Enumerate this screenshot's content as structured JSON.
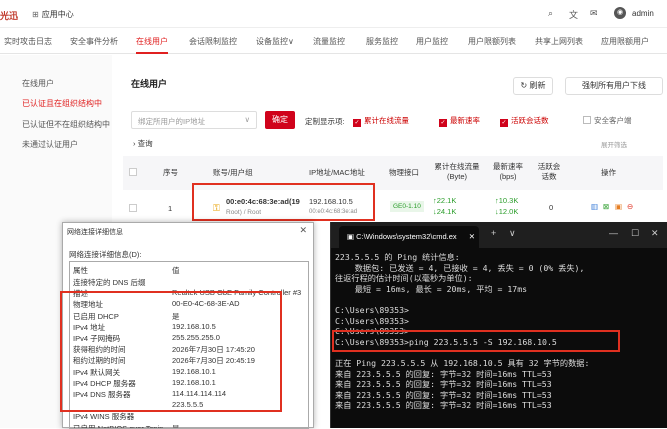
{
  "topbar": {
    "logo": "光迅",
    "app_center": "应用中心",
    "admin": "admin"
  },
  "nav": [
    "实时攻击日志",
    "安全事件分析",
    "在线用户",
    "会话限制监控",
    "设备监控∨",
    "流量监控",
    "服务监控",
    "用户监控",
    "用户限额列表",
    "共享上网列表",
    "应用限额用户"
  ],
  "left": [
    "在线用户",
    "已认证且在组织结构中",
    "已认证但不在组织结构中",
    "未通过认证用户"
  ],
  "main": {
    "title": "在线用户",
    "refresh": "刷新",
    "force_offline": "强制所有用户下线",
    "select_placeholder": "绑定所用户的IP地址",
    "confirm": "确定",
    "custom_label": "定制显示项:",
    "checks": [
      "累计在线流量",
      "最新速率",
      "活跃会话数",
      "安全客户端"
    ],
    "query": "查询",
    "expand": "展开筛选",
    "headers": [
      "序号",
      "账号/用户组",
      "IP地址/MAC地址",
      "物理接口",
      "累计在线流量 (Byte)",
      "最新速率 (bps)",
      "活跃会话数",
      "操作"
    ],
    "row": {
      "no": "1",
      "account": "00:e0:4c:68:3e:ad(19",
      "group": "Root) / Root",
      "ip": "192.168.10.5",
      "mac": "00:e0:4c:68:3e:ad",
      "iface": "GE0-1.10",
      "up": "↑22.1K",
      "down": "↓24.1K",
      "rate_up": "↑10.3K",
      "rate_down": "↓12.0K",
      "sessions": "0"
    }
  },
  "dialog": {
    "title": "网络连接详细信息",
    "label": "网络连接详细信息(D):",
    "col_prop": "属性",
    "col_val": "值",
    "rows": [
      [
        "连接特定的 DNS 后缀",
        ""
      ],
      [
        "描述",
        "Realtek USB GbE Family Controller #3"
      ],
      [
        "物理地址",
        "00-E0-4C-68-3E-AD"
      ],
      [
        "已启用 DHCP",
        "是"
      ],
      [
        "IPv4 地址",
        "192.168.10.5"
      ],
      [
        "IPv4 子网掩码",
        "255.255.255.0"
      ],
      [
        "获得租约的时间",
        "2026年7月30日 17:45:20"
      ],
      [
        "租约过期的时间",
        "2026年7月30日 20:45:19"
      ],
      [
        "IPv4 默认网关",
        "192.168.10.1"
      ],
      [
        "IPv4 DHCP 服务器",
        "192.168.10.1"
      ],
      [
        "IPv4 DNS 服务器",
        "114.114.114.114"
      ],
      [
        "",
        "223.5.5.5"
      ],
      [
        "IPv4 WINS 服务器",
        ""
      ],
      [
        "已启用 NetBIOS over Tcpip",
        "是"
      ]
    ]
  },
  "cmd": {
    "title": "C:\\Windows\\system32\\cmd.ex",
    "lines": [
      "223.5.5.5 的 Ping 统计信息:",
      "    数据包: 已发送 = 4, 已接收 = 4, 丢失 = 0 (0% 丢失),",
      "往返行程的估计时间(以毫秒为单位):",
      "    最短 = 16ms, 最长 = 20ms, 平均 = 17ms",
      "",
      "C:\\Users\\89353>",
      "C:\\Users\\89353>",
      "C:\\Users\\89353>",
      "C:\\Users\\89353>ping 223.5.5.5 -S 192.168.10.5",
      "",
      "正在 Ping 223.5.5.5 从 192.168.10.5 具有 32 字节的数据:",
      "来自 223.5.5.5 的回复: 字节=32 时间=16ms TTL=53",
      "来自 223.5.5.5 的回复: 字节=32 时间=16ms TTL=53",
      "来自 223.5.5.5 的回复: 字节=32 时间=16ms TTL=53",
      "来自 223.5.5.5 的回复: 字节=32 时间=16ms TTL=53"
    ]
  }
}
